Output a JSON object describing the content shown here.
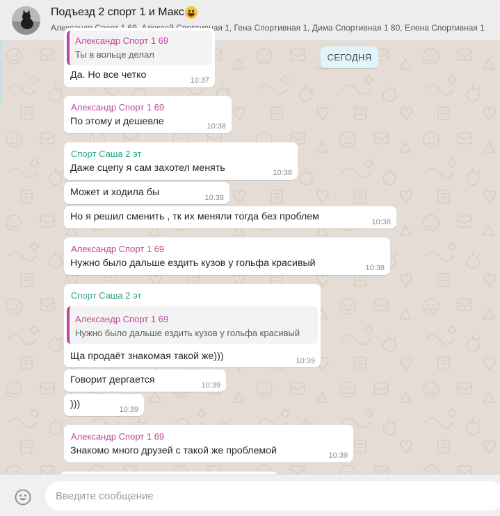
{
  "header": {
    "title": "Подъезд 2 спорт 1 и Макс",
    "title_emoji": "grinning-face",
    "members": "Александр Спорт 1 69, Алексей Спортивная 1, Гена Спортивная 1, Дима Спортивная 1 80, Елена Спортивная 1"
  },
  "date_chip": "СЕГОДНЯ",
  "colors": {
    "sender_magenta": "#c1449c",
    "sender_teal": "#25a38b",
    "wallpaper": "#e5ddd5",
    "date_chip_bg": "#e1f3fb"
  },
  "messages": [
    {
      "quote_sender": "Александр Спорт 1 69",
      "quote_text": "Ты в вольце делал",
      "text": "Да. Но все четко",
      "time": "10:37"
    },
    {
      "sender": "Александр Спорт 1 69",
      "sender_color": "magenta",
      "text": "По этому и дешевле",
      "time": "10:38"
    },
    {
      "sender": "Спорт Саша 2 эт",
      "sender_color": "teal",
      "text": "Даже сцепу я сам захотел менять",
      "time": "10:38"
    },
    {
      "text": "Может и ходила бы",
      "time": "10:38"
    },
    {
      "text": "Но я решил сменить , тк их меняли тогда без проблем",
      "time": "10:38"
    },
    {
      "sender": "Александр Спорт 1 69",
      "sender_color": "magenta",
      "text": "Нужно было дальше ездить кузов у гольфа красивый",
      "time": "10:38"
    },
    {
      "sender": "Спорт Саша 2 эт",
      "sender_color": "teal",
      "quote_sender": "Александр Спорт 1 69",
      "quote_text": "Нужно было дальше ездить кузов у гольфа красивый",
      "text": "Ща продаёт знакомая такой же)))",
      "time": "10:39"
    },
    {
      "text": "Говорит дергается",
      "time": "10:39"
    },
    {
      "text": ")))",
      "time": "10:39"
    },
    {
      "sender": "Александр Спорт 1 69",
      "sender_color": "magenta",
      "text": "Знакомо много друзей с такой же проблемой",
      "time": "10:39"
    }
  ],
  "composer": {
    "placeholder": "Введите сообщение",
    "emoji_icon": "smiley-icon"
  }
}
